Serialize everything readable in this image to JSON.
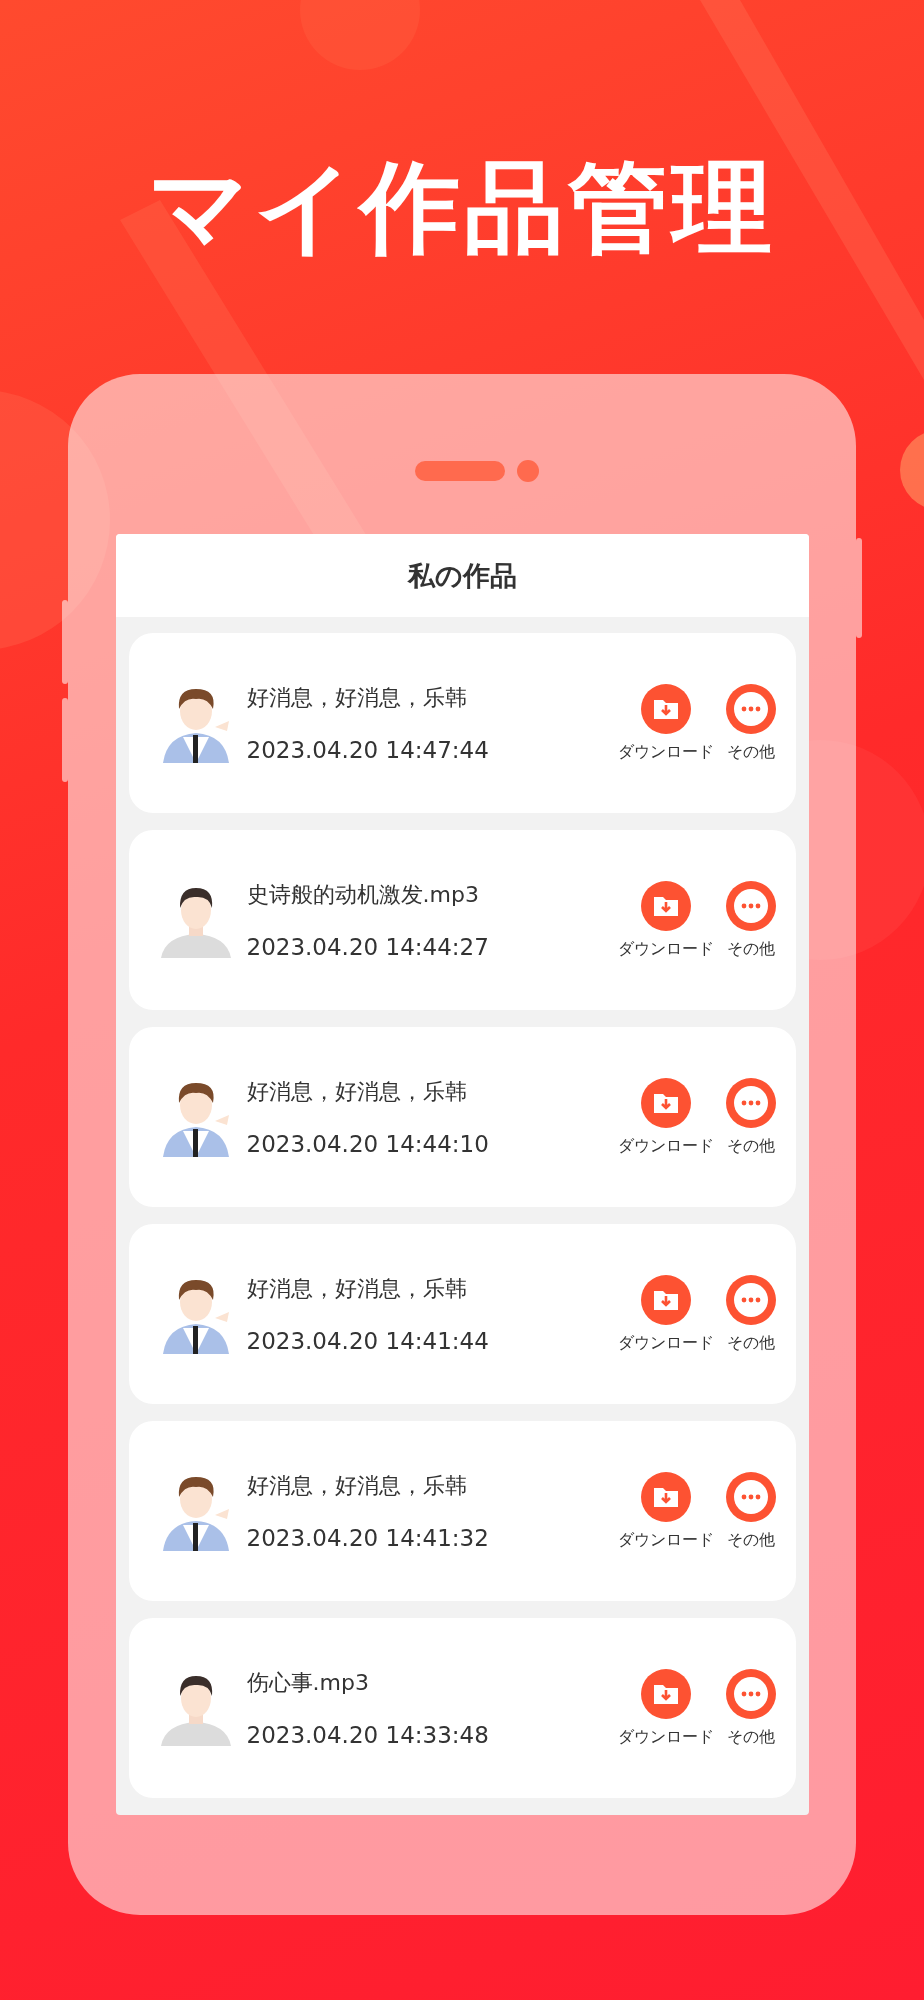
{
  "headline": "マイ作品管理",
  "screen": {
    "title": "私の作品",
    "works": [
      {
        "kind": "character",
        "title": "好消息，好消息，乐韩",
        "date": "2023.04.20 14:47:44",
        "download": "ダウンロード",
        "more": "その他"
      },
      {
        "kind": "default",
        "title": "史诗般的动机激发.mp3",
        "date": "2023.04.20 14:44:27",
        "download": "ダウンロード",
        "more": "その他"
      },
      {
        "kind": "character",
        "title": "好消息，好消息，乐韩",
        "date": "2023.04.20 14:44:10",
        "download": "ダウンロード",
        "more": "その他"
      },
      {
        "kind": "character",
        "title": "好消息，好消息，乐韩",
        "date": "2023.04.20 14:41:44",
        "download": "ダウンロード",
        "more": "その他"
      },
      {
        "kind": "character",
        "title": "好消息，好消息，乐韩",
        "date": "2023.04.20 14:41:32",
        "download": "ダウンロード",
        "more": "その他"
      },
      {
        "kind": "default",
        "title": "伤心事.mp3",
        "date": "2023.04.20 14:33:48",
        "download": "ダウンロード",
        "more": "その他"
      }
    ]
  }
}
